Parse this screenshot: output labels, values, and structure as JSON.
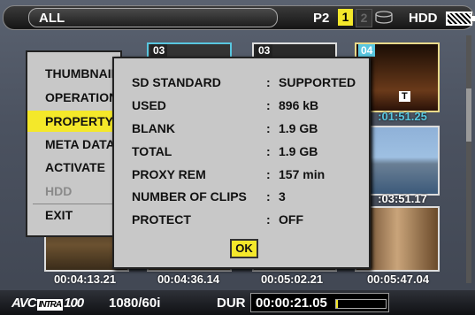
{
  "topbar": {
    "folder": "ALL",
    "p2_label": "P2",
    "slot1": "1",
    "slot2": "2",
    "hdd_label": "HDD",
    "battery_icon": "battery-icon"
  },
  "thumbnails": [
    {
      "number": "03",
      "badge": "",
      "time": ""
    },
    {
      "number": "03",
      "badge": "",
      "time": ""
    },
    {
      "number": "04",
      "badge": "T",
      "time": ":01:51.25"
    },
    {
      "number": "",
      "badge": "",
      "time": ":03:51.17"
    },
    {
      "number": "",
      "badge": "",
      "time": "00:04:13.21"
    },
    {
      "number": "",
      "badge": "",
      "time": "00:04:36.14"
    },
    {
      "number": "",
      "badge": "",
      "time": "00:05:02.21"
    },
    {
      "number": "",
      "badge": "",
      "time": "00:05:47.04"
    }
  ],
  "menu": {
    "items": [
      {
        "label": "THUMBNAIL",
        "state": "normal"
      },
      {
        "label": "OPERATION",
        "state": "normal"
      },
      {
        "label": "PROPERTY",
        "state": "active"
      },
      {
        "label": "META DATA",
        "state": "normal"
      },
      {
        "label": "ACTIVATE",
        "state": "normal"
      },
      {
        "label": "HDD",
        "state": "disabled"
      },
      {
        "label": "EXIT",
        "state": "normal"
      }
    ]
  },
  "property": {
    "rows": [
      {
        "key": "SD STANDARD",
        "sep": ":",
        "value": "SUPPORTED"
      },
      {
        "key": "USED",
        "sep": ":",
        "value": "896 kB"
      },
      {
        "key": "BLANK",
        "sep": ":",
        "value": "1.9 GB"
      },
      {
        "key": "TOTAL",
        "sep": ":",
        "value": "1.9 GB"
      },
      {
        "key": "PROXY REM",
        "sep": ":",
        "value": "157 min"
      },
      {
        "key": "NUMBER OF CLIPS",
        "sep": ":",
        "value": "3"
      },
      {
        "key": "PROTECT",
        "sep": ":",
        "value": "OFF"
      }
    ],
    "ok_label": "OK"
  },
  "bottombar": {
    "codec_prefix": "AVC",
    "codec_intra": "INTRA",
    "codec_suffix": "100",
    "format": "1080/60i",
    "dur_label": "DUR",
    "dur_value": "00:00:21.05",
    "dur_progress_pct": 3
  },
  "colors": {
    "highlight": "#f4e82a",
    "selection": "#58c6df"
  }
}
